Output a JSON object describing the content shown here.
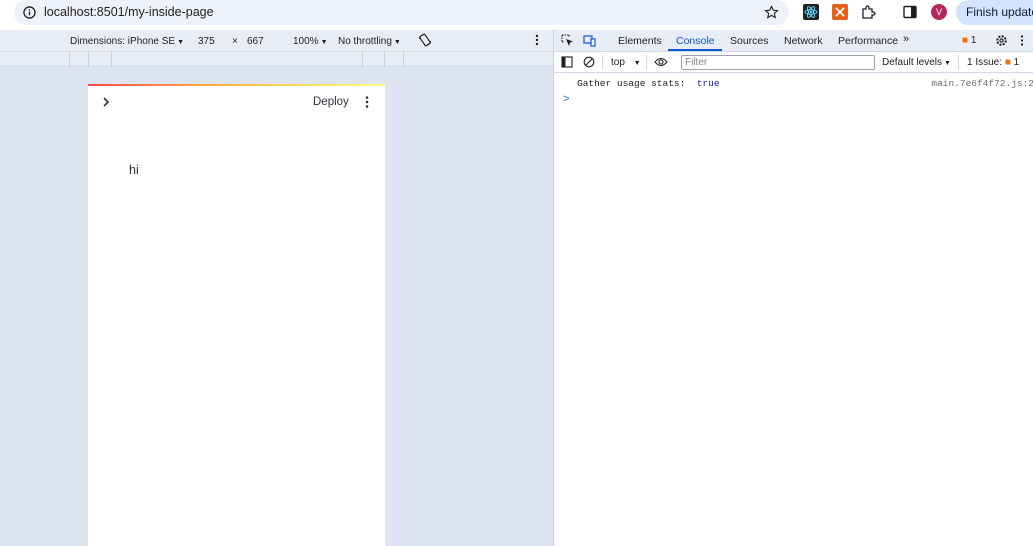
{
  "browser": {
    "url": "localhost:8501/my-inside-page",
    "update_button": "Finish update",
    "avatar_initial": "V"
  },
  "device_toolbar": {
    "dimensions_label": "Dimensions: iPhone SE",
    "width": "375",
    "times": "×",
    "height": "667",
    "zoom": "100%",
    "throttling": "No throttling"
  },
  "page": {
    "deploy_label": "Deploy",
    "body_text": "hi",
    "accent_gradient": [
      "#ff4b4b",
      "#ffbd45",
      "#fffd80"
    ]
  },
  "devtools": {
    "tabs": [
      "Elements",
      "Console",
      "Sources",
      "Network",
      "Performance"
    ],
    "active_tab": "Console",
    "issue_count": "1",
    "console": {
      "context": "top",
      "filter_placeholder": "Filter",
      "levels_label": "Default levels",
      "issues_label": "1 Issue:",
      "issues_count": "1",
      "log_message": "Gather usage stats:",
      "log_value": "true",
      "log_source": "main.7e6f4f72.js:2",
      "prompt": ">"
    }
  },
  "colors": {
    "accent_blue": "#0b57d0",
    "streamlit_red": "#ff4b4b",
    "warning_orange": "#e8710a"
  }
}
